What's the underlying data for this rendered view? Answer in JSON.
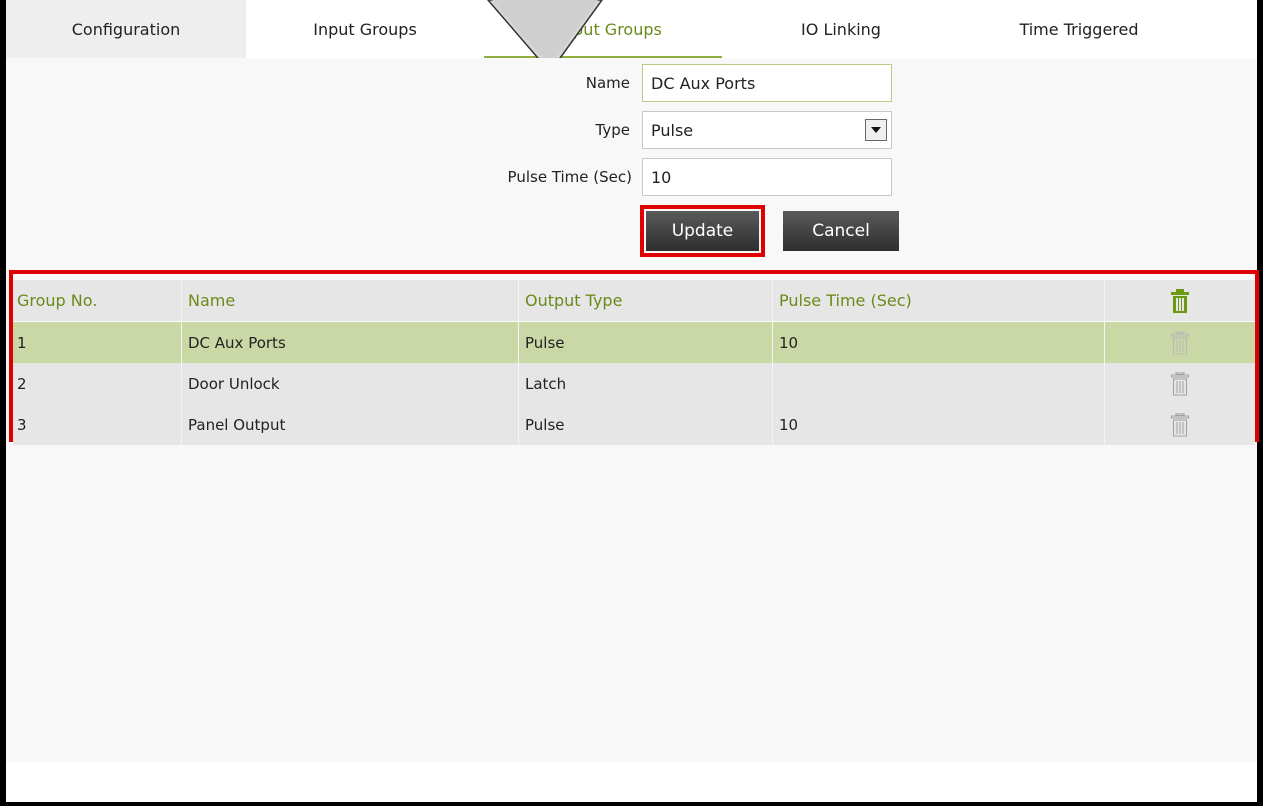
{
  "tabs": [
    {
      "label": "Configuration"
    },
    {
      "label": "Input Groups"
    },
    {
      "label": "Output Groups"
    },
    {
      "label": "IO Linking"
    },
    {
      "label": "Time Triggered"
    }
  ],
  "active_tab": "Output Groups",
  "form": {
    "name_label": "Name",
    "name_value": "DC Aux Ports",
    "type_label": "Type",
    "type_value": "Pulse",
    "pulse_label": "Pulse Time (Sec)",
    "pulse_value": "10",
    "update_label": "Update",
    "cancel_label": "Cancel"
  },
  "table": {
    "headers": [
      "Group No.",
      "Name",
      "Output Type",
      "Pulse Time (Sec)"
    ],
    "rows": [
      {
        "no": "1",
        "name": "DC Aux Ports",
        "type": "Pulse",
        "time": "10",
        "selected": true
      },
      {
        "no": "2",
        "name": "Door Unlock",
        "type": "Latch",
        "time": "",
        "selected": false
      },
      {
        "no": "3",
        "name": "Panel Output",
        "type": "Pulse",
        "time": "10",
        "selected": false
      }
    ]
  },
  "icons": {
    "header_delete": "trash-icon",
    "row_delete": "trash-icon",
    "select_arrow": "chevron-down-icon"
  },
  "colors": {
    "accent_green": "#6b8a1a",
    "selected_row": "#cad8a6",
    "highlight_red": "#e00000",
    "button_dark": "#3a3a3a"
  }
}
